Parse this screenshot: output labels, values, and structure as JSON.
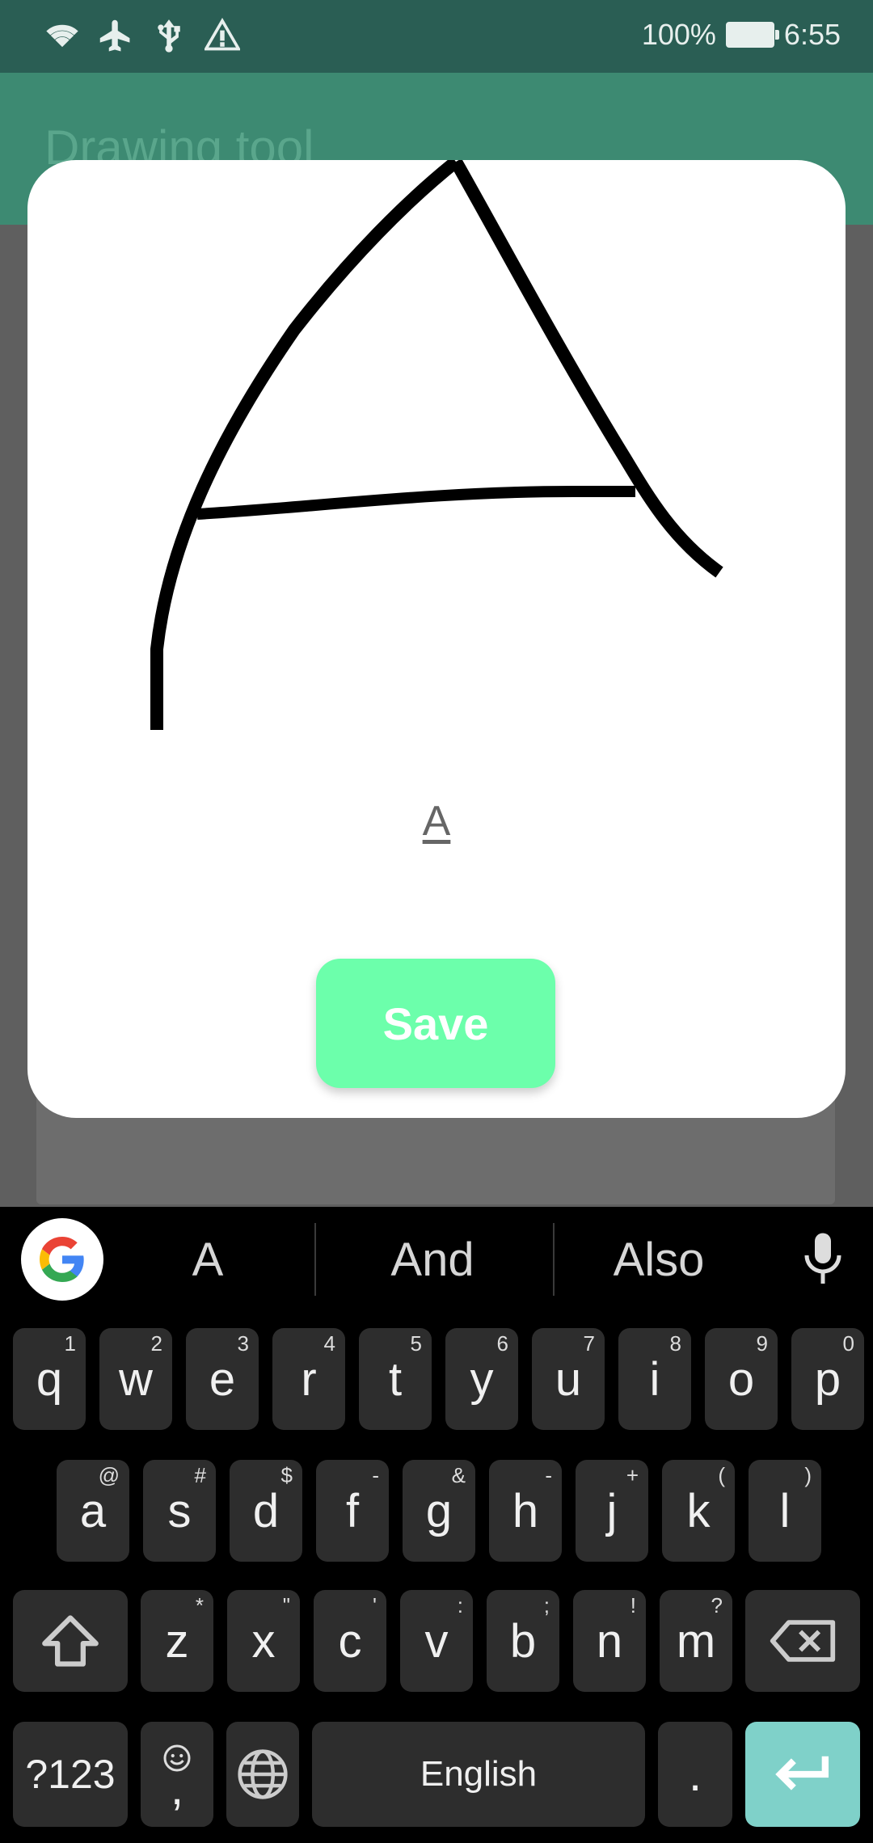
{
  "status_bar": {
    "battery": "100%",
    "time": "6:55"
  },
  "app": {
    "title": "Drawing tool"
  },
  "dialog": {
    "recognized_text": "A",
    "save_label": "Save"
  },
  "keyboard": {
    "suggestions": [
      "A",
      "And",
      "Also"
    ],
    "row1": [
      {
        "k": "q",
        "s": "1"
      },
      {
        "k": "w",
        "s": "2"
      },
      {
        "k": "e",
        "s": "3"
      },
      {
        "k": "r",
        "s": "4"
      },
      {
        "k": "t",
        "s": "5"
      },
      {
        "k": "y",
        "s": "6"
      },
      {
        "k": "u",
        "s": "7"
      },
      {
        "k": "i",
        "s": "8"
      },
      {
        "k": "o",
        "s": "9"
      },
      {
        "k": "p",
        "s": "0"
      }
    ],
    "row2": [
      {
        "k": "a",
        "s": "@"
      },
      {
        "k": "s",
        "s": "#"
      },
      {
        "k": "d",
        "s": "$"
      },
      {
        "k": "f",
        "s": "-"
      },
      {
        "k": "g",
        "s": "&"
      },
      {
        "k": "h",
        "s": "-"
      },
      {
        "k": "j",
        "s": "+"
      },
      {
        "k": "k",
        "s": "("
      },
      {
        "k": "l",
        "s": ")"
      }
    ],
    "row3": [
      {
        "k": "z",
        "s": "*"
      },
      {
        "k": "x",
        "s": "\""
      },
      {
        "k": "c",
        "s": "'"
      },
      {
        "k": "v",
        "s": ":"
      },
      {
        "k": "b",
        "s": ";"
      },
      {
        "k": "n",
        "s": "!"
      },
      {
        "k": "m",
        "s": "?"
      }
    ],
    "symbols_label": "?123",
    "comma_label": ",",
    "space_label": "English",
    "period_label": "."
  }
}
